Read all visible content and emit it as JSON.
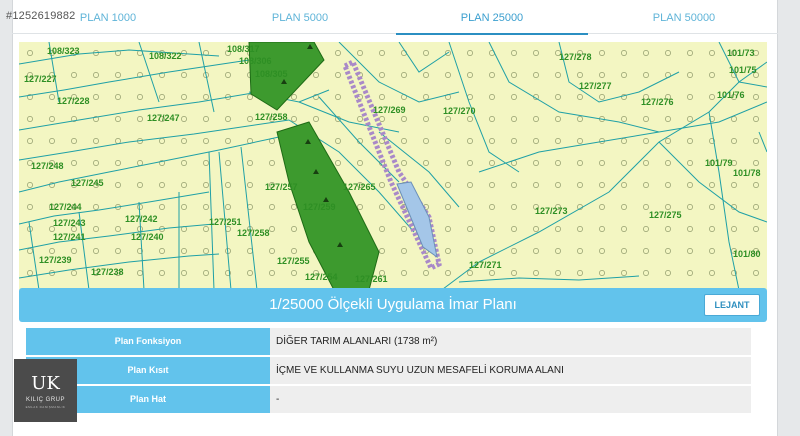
{
  "listing_id": "#1252619882",
  "tabs": [
    {
      "label": "PLAN 1000",
      "active": false
    },
    {
      "label": "PLAN 5000",
      "active": false
    },
    {
      "label": "PLAN 25000",
      "active": true
    },
    {
      "label": "PLAN 50000",
      "active": false
    }
  ],
  "map": {
    "parcel_labels": [
      "108/323",
      "108/322",
      "108/317",
      "108/306",
      "108/305",
      "127/278",
      "127/277",
      "101/73",
      "101/75",
      "101/76",
      "127/227",
      "127/228",
      "127/247",
      "127/258",
      "127/269",
      "127/270",
      "127/276",
      "127/248",
      "127/245",
      "127/257",
      "127/265",
      "101/79",
      "101/78",
      "127/244",
      "127/243",
      "127/241",
      "127/242",
      "127/240",
      "127/251",
      "127/259",
      "127/273",
      "127/275",
      "127/258",
      "127/239",
      "127/238",
      "127/255",
      "127/254",
      "127/261",
      "127/271",
      "101/80"
    ],
    "colors": {
      "background": "#f3f6c2",
      "forest": "#3d9a2e",
      "protection": "#a4c6e8",
      "boundary": "#a989c8",
      "parcel_line": "#1fa0a6"
    }
  },
  "plan_title": "1/25000 Ölçekli Uygulama İmar Planı",
  "legend_button": "LEJANT",
  "info": [
    {
      "label": "Plan Fonksiyon",
      "value": "DİĞER TARIM ALANLARI (1738 m²)"
    },
    {
      "label": "Plan Kısıt",
      "value": "İÇME VE KULLANMA SUYU UZUN MESAFELİ KORUMA ALANI"
    },
    {
      "label": "Plan Hat",
      "value": "-"
    }
  ],
  "logo": {
    "mark": "UK",
    "name": "KILIÇ GRUP",
    "sub": "EMLAK DANIŞMANLIK"
  }
}
